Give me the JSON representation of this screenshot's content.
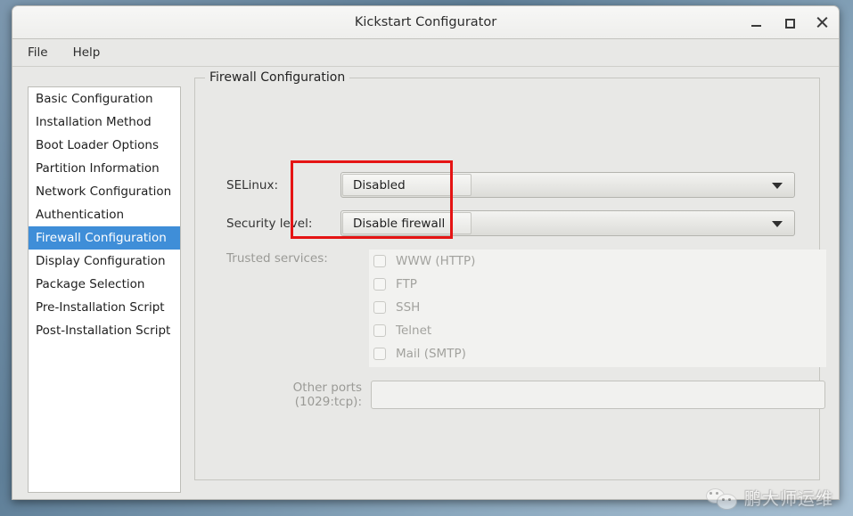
{
  "window": {
    "title": "Kickstart Configurator",
    "controls": {
      "minimize": "minimize-button",
      "maximize": "maximize-button",
      "close": "close-button"
    }
  },
  "menubar": {
    "items": [
      {
        "label": "File"
      },
      {
        "label": "Help"
      }
    ]
  },
  "sidebar": {
    "items": [
      {
        "label": "Basic Configuration",
        "selected": false
      },
      {
        "label": "Installation Method",
        "selected": false
      },
      {
        "label": "Boot Loader Options",
        "selected": false
      },
      {
        "label": "Partition Information",
        "selected": false
      },
      {
        "label": "Network Configuration",
        "selected": false
      },
      {
        "label": "Authentication",
        "selected": false
      },
      {
        "label": "Firewall Configuration",
        "selected": true
      },
      {
        "label": "Display Configuration",
        "selected": false
      },
      {
        "label": "Package Selection",
        "selected": false
      },
      {
        "label": "Pre-Installation Script",
        "selected": false
      },
      {
        "label": "Post-Installation Script",
        "selected": false
      }
    ]
  },
  "main": {
    "group_title": "Firewall Configuration",
    "selinux": {
      "label": "SELinux:",
      "value": "Disabled"
    },
    "security_level": {
      "label": "Security level:",
      "value": "Disable firewall"
    },
    "trusted_services": {
      "label": "Trusted services:",
      "enabled": false,
      "items": [
        {
          "label": "WWW (HTTP)",
          "checked": false
        },
        {
          "label": "FTP",
          "checked": false
        },
        {
          "label": "SSH",
          "checked": false
        },
        {
          "label": "Telnet",
          "checked": false
        },
        {
          "label": "Mail (SMTP)",
          "checked": false
        }
      ]
    },
    "other_ports": {
      "label": "Other ports (1029:tcp):",
      "value": "",
      "placeholder": "",
      "enabled": false
    }
  },
  "annotation": {
    "color": "#e51414",
    "shape": "rectangle-outline"
  },
  "watermark": {
    "text": "鹏大师运维",
    "icon": "wechat-icon"
  },
  "colors": {
    "selection_blue": "#3f8ed8",
    "window_bg": "#e8e8e6",
    "annotation_red": "#e51414",
    "desktop_gradient_start": "#7c97ae",
    "desktop_gradient_end": "#a7bfd2"
  }
}
